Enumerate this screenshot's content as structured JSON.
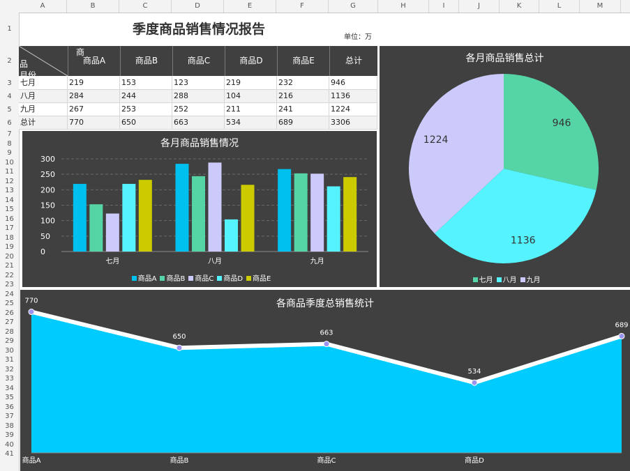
{
  "sheet": {
    "columns": [
      "A",
      "B",
      "C",
      "D",
      "E",
      "F",
      "G",
      "H",
      "I",
      "J",
      "K",
      "L",
      "M"
    ],
    "rows": [
      "1",
      "2",
      "3",
      "4",
      "5",
      "6",
      "7",
      "8",
      "9",
      "10",
      "11",
      "12",
      "13",
      "14",
      "15",
      "16",
      "17",
      "18",
      "19",
      "20",
      "21",
      "22",
      "23",
      "24",
      "25",
      "26",
      "27",
      "28",
      "29",
      "30",
      "31",
      "32",
      "33",
      "34",
      "35",
      "36",
      "37",
      "38",
      "39",
      "40",
      "41"
    ]
  },
  "report": {
    "title": "季度商品销售情况报告",
    "unit": "单位：万",
    "header_diag_top": "商",
    "header_diag_mid": "品",
    "header_diag_bottom": "月份",
    "headers": [
      "商品A",
      "商品B",
      "商品C",
      "商品D",
      "商品E",
      "总计"
    ],
    "rows": [
      {
        "label": "七月",
        "values": [
          "219",
          "153",
          "123",
          "219",
          "232",
          "946"
        ]
      },
      {
        "label": "八月",
        "values": [
          "284",
          "244",
          "288",
          "104",
          "216",
          "1136"
        ]
      },
      {
        "label": "九月",
        "values": [
          "267",
          "253",
          "252",
          "211",
          "241",
          "1224"
        ]
      },
      {
        "label": "总计",
        "values": [
          "770",
          "650",
          "663",
          "534",
          "689",
          "3306"
        ]
      }
    ]
  },
  "colors": {
    "panel_bg": "#404040",
    "series": [
      "#00c0f0",
      "#55d4a6",
      "#cccafb",
      "#55f3fd",
      "#cbcb00"
    ],
    "months": [
      "#55d4a6",
      "#55f3fd",
      "#cccafb"
    ],
    "area": "#00cbff",
    "line": "#ffffff",
    "marker": "#9a94f0"
  },
  "chart_data": [
    {
      "type": "bar",
      "title": "各月商品销售情况",
      "categories": [
        "七月",
        "八月",
        "九月"
      ],
      "series": [
        {
          "name": "商品A",
          "values": [
            219,
            284,
            267
          ]
        },
        {
          "name": "商品B",
          "values": [
            153,
            244,
            253
          ]
        },
        {
          "name": "商品C",
          "values": [
            123,
            288,
            252
          ]
        },
        {
          "name": "商品D",
          "values": [
            219,
            104,
            211
          ]
        },
        {
          "name": "商品E",
          "values": [
            232,
            216,
            241
          ]
        }
      ],
      "ylim": [
        0,
        300
      ],
      "yticks": [
        "0",
        "50",
        "100",
        "150",
        "200",
        "250",
        "300"
      ],
      "grid": true,
      "legend": "bottom"
    },
    {
      "type": "pie",
      "title": "各月商品销售总计",
      "labels": [
        "七月",
        "八月",
        "九月"
      ],
      "values": [
        946,
        1136,
        1224
      ],
      "data_labels": [
        "946",
        "1136",
        "1224"
      ],
      "legend": "bottom"
    },
    {
      "type": "area",
      "title": "各商品季度总销售统计",
      "categories": [
        "商品A",
        "商品B",
        "商品C",
        "商品D",
        "商品E"
      ],
      "values": [
        770,
        650,
        663,
        534,
        689
      ],
      "data_labels": [
        "770",
        "650",
        "663",
        "534",
        "689"
      ],
      "tick_labels": [
        "商品A",
        "商品B",
        "商品C",
        "商品D"
      ]
    }
  ]
}
